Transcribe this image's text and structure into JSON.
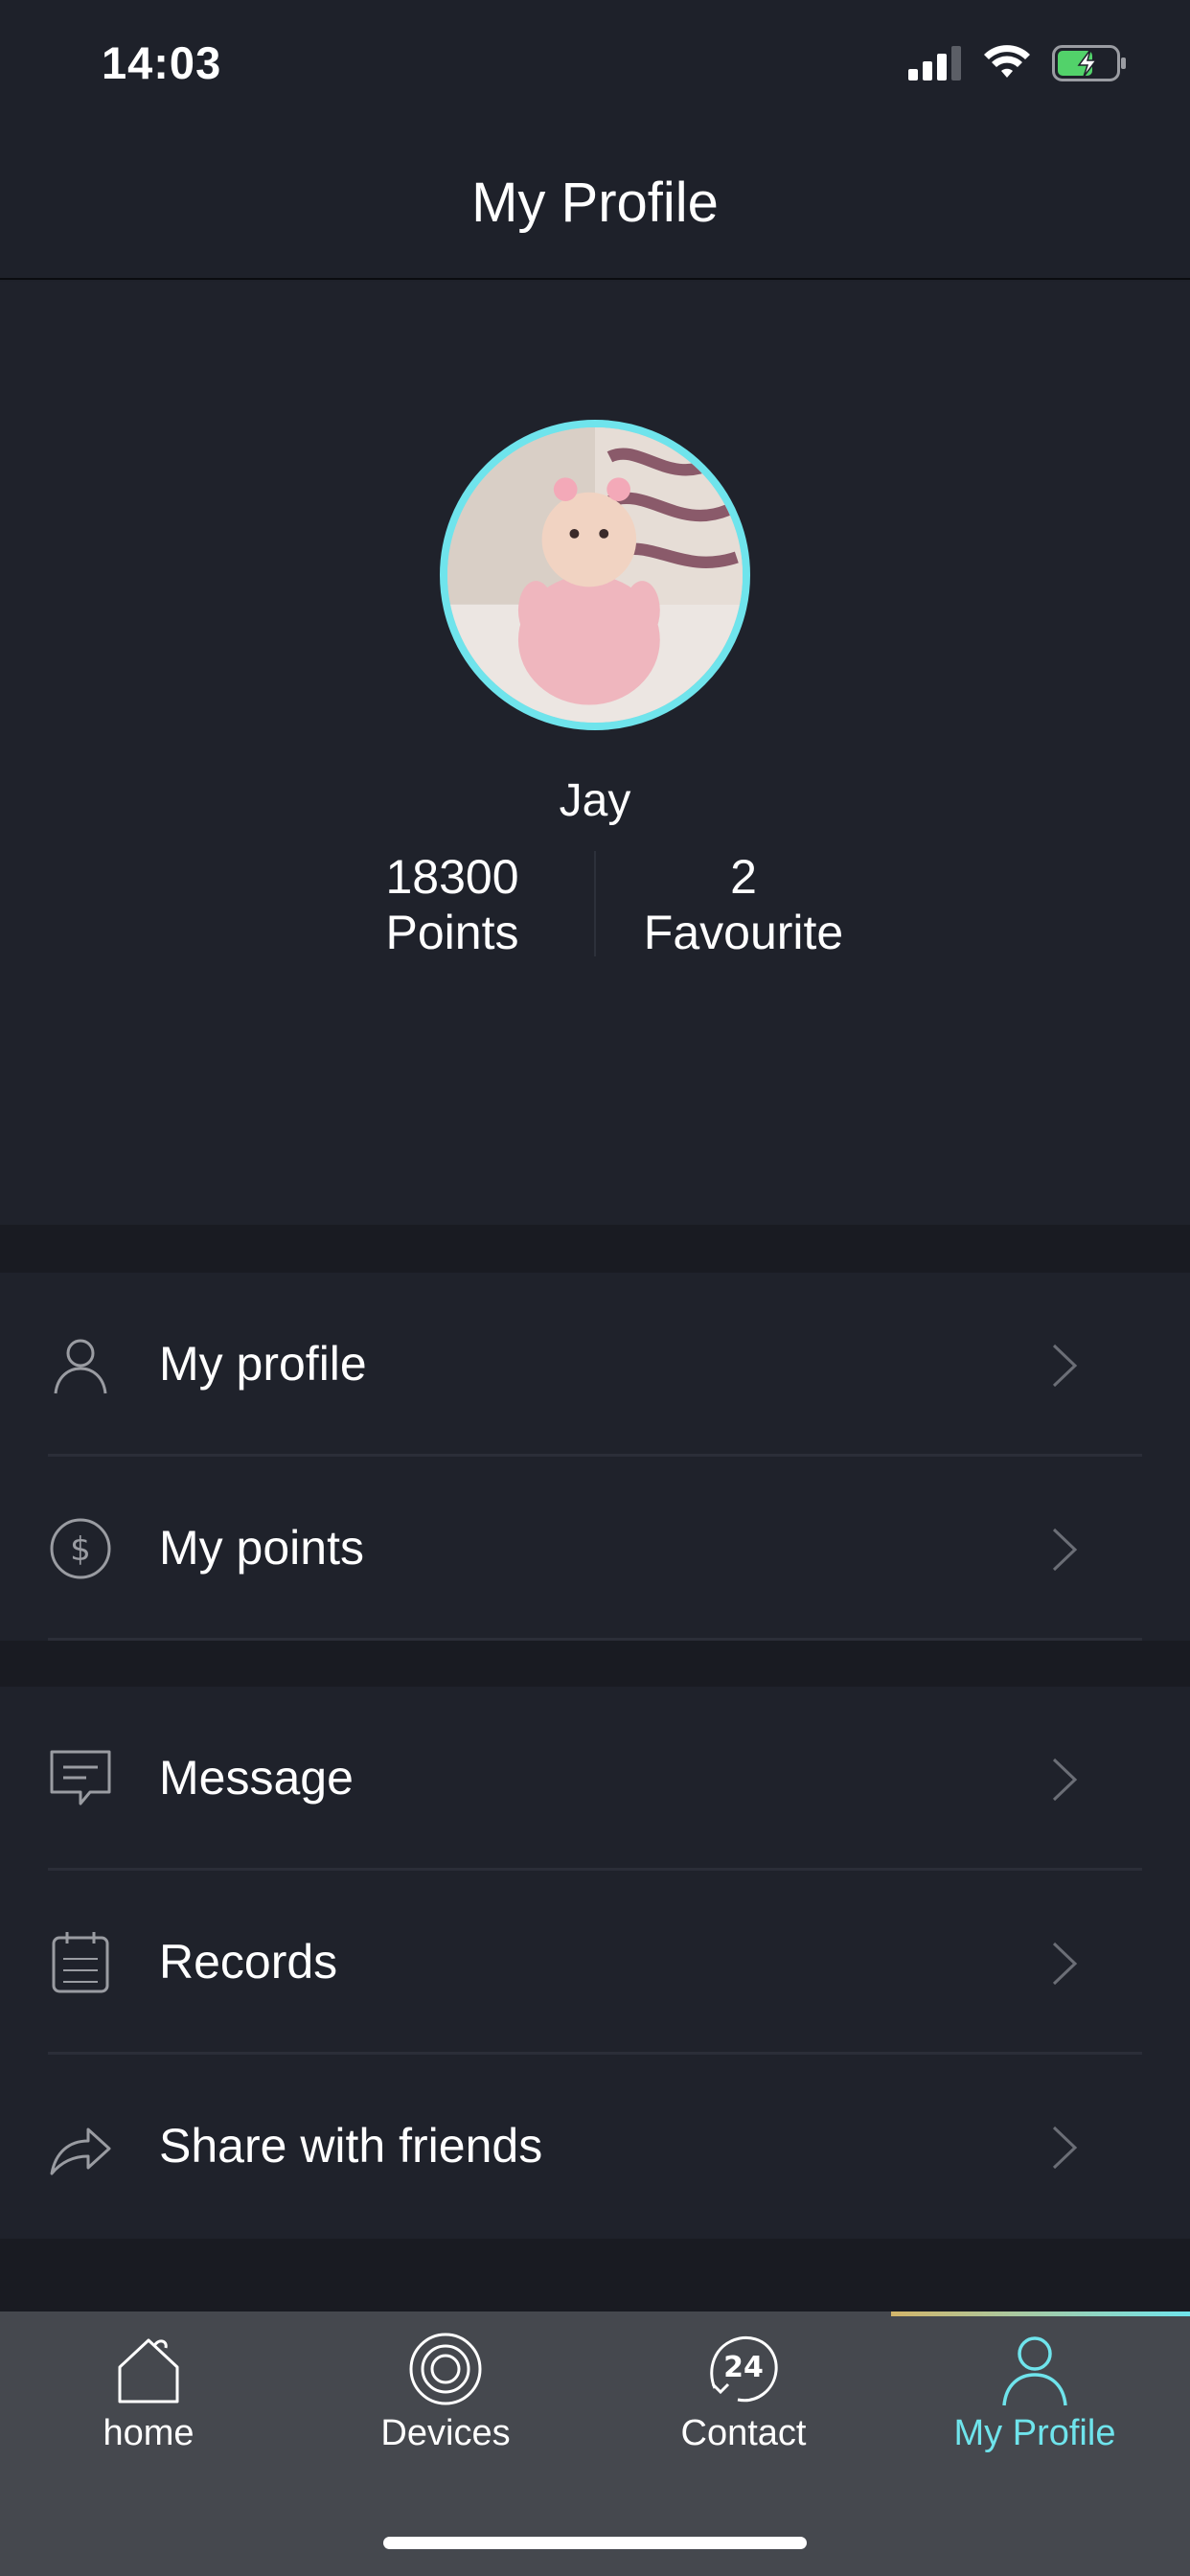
{
  "status_bar": {
    "time": "14:03"
  },
  "nav": {
    "title": "My Profile"
  },
  "profile": {
    "name": "Jay",
    "points_value": "18300",
    "points_label": "Points",
    "favourite_value": "2",
    "favourite_label": "Favourite"
  },
  "menu": {
    "group1": [
      {
        "label": "My profile",
        "icon": "person-icon"
      },
      {
        "label": "My points",
        "icon": "dollar-coin-icon"
      }
    ],
    "group2": [
      {
        "label": "Message",
        "icon": "message-icon"
      },
      {
        "label": "Records",
        "icon": "notepad-icon"
      },
      {
        "label": "Share with friends",
        "icon": "share-icon"
      }
    ]
  },
  "tabs": [
    {
      "label": "home",
      "icon": "house-icon"
    },
    {
      "label": "Devices",
      "icon": "devices-icon"
    },
    {
      "label": "Contact",
      "icon": "support-24-icon"
    },
    {
      "label": "My Profile",
      "icon": "person-icon",
      "active": true
    }
  ],
  "colors": {
    "accent": "#6fe4ec",
    "background": "#1e212a",
    "tab_bar": "#45484e"
  }
}
